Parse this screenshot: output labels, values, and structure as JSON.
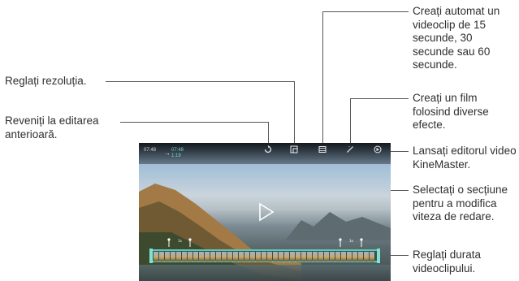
{
  "callouts": {
    "resolution": "Reglați rezoluția.",
    "revert": "Reveniți la editarea anterioară.",
    "auto_clip": "Creați automat un videoclip de 15 secunde, 30 secunde sau 60 secunde.",
    "film": "Creați un film folosind diverse efecte.",
    "kinemaster": "Lansați editorul video KineMaster.",
    "speed": "Selectați o secțiune pentru a modifica viteza de redare.",
    "duration": "Reglați durata videoclipului."
  },
  "screenshot": {
    "time_start": "07:48",
    "time_end": "07:48",
    "time_end_sub": "1:19"
  },
  "icons": {
    "undo": "undo-icon",
    "resolution": "resolution-icon",
    "auto_clip": "film-clip-icon",
    "film": "magic-wand-icon",
    "kinemaster": "kinemaster-icon",
    "play": "play-icon"
  },
  "colors": {
    "accent": "#5cc9b6",
    "callout_line": "#555555"
  }
}
